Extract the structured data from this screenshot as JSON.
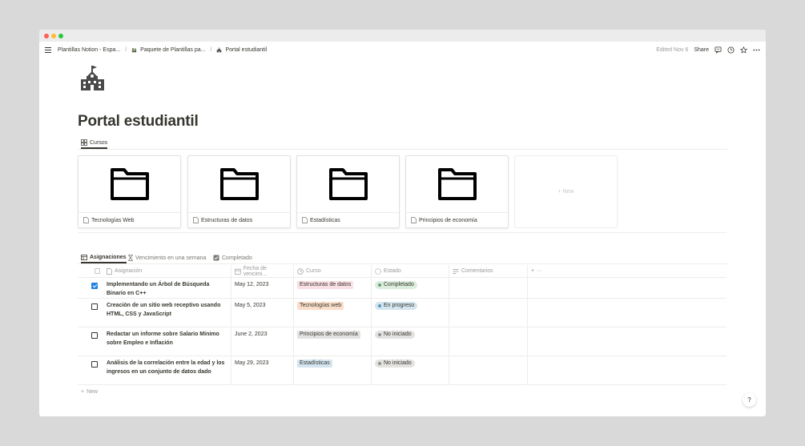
{
  "breadcrumb": {
    "items": [
      "Plantillas Notion - Espa...",
      "Paquete de Plantillas pa...",
      "Portal estudiantil"
    ]
  },
  "topbar": {
    "edited": "Edited Nov 6",
    "share": "Share"
  },
  "page": {
    "title": "Portal estudiantil"
  },
  "views": {
    "cursos_tab": "Cursos"
  },
  "gallery": {
    "cards": [
      "Tecnologías Web",
      "Estructuras de datos",
      "Estadísticas",
      "Principios de economía"
    ],
    "new_label": "+ New"
  },
  "table_tabs": [
    "Asignaciones",
    "Vencimiento en una semana",
    "Completado"
  ],
  "table": {
    "columns": [
      "Asignación",
      "Fecha de vencimi...",
      "Curso",
      "Estado",
      "Comentarios"
    ],
    "rows": [
      {
        "checked": true,
        "name": "Implementando un Árbol de Búsqueda Binario en C++",
        "date": "May 12, 2023",
        "course": "Estructuras de datos",
        "course_bg": "#fadfe4",
        "status": "Completado",
        "status_bg": "#dbeddb",
        "status_dot": "#6c9b7d"
      },
      {
        "checked": false,
        "name": "Creación de un sitio web receptivo usando HTML, CSS y JavaScript",
        "date": "May 5, 2023",
        "course": "Tecnologías web",
        "course_bg": "#fadec9",
        "status": "En progreso",
        "status_bg": "#d3e5ef",
        "status_dot": "#5b97bd"
      },
      {
        "checked": false,
        "name": "Redactar un informe sobre Salario Mínimo sobre Empleo e Inflación",
        "date": "June 2, 2023",
        "course": "Principios de economía",
        "course_bg": "#e3e2e0",
        "status": "No iniciado",
        "status_bg": "#e3e2e0",
        "status_dot": "#91918e"
      },
      {
        "checked": false,
        "name": "Análisis de la correlación entre la edad y los ingresos en un conjunto de datos dado",
        "date": "May 29, 2023",
        "course": "Estadísticas",
        "course_bg": "#d3e5ef",
        "status": "No iniciado",
        "status_bg": "#e3e2e0",
        "status_dot": "#91918e"
      }
    ],
    "new_label": "New"
  },
  "help": "?"
}
